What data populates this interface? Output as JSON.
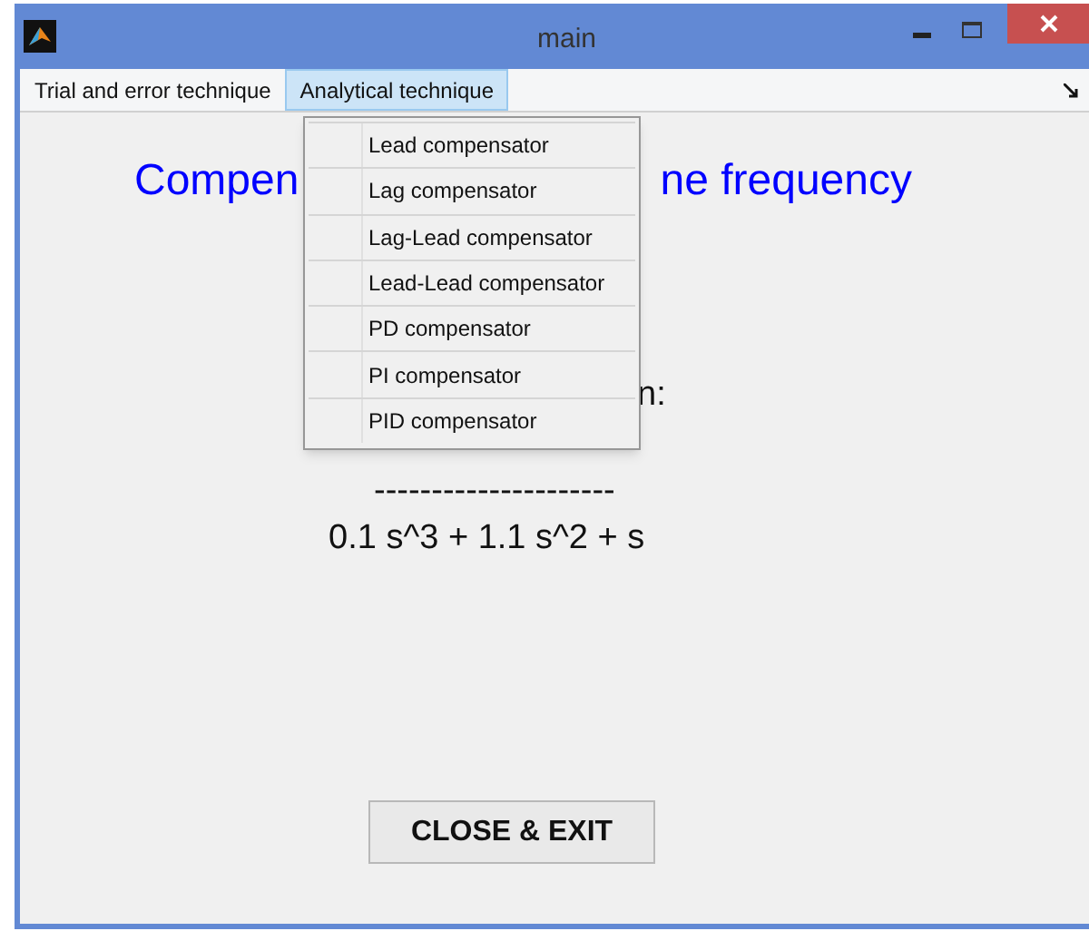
{
  "window": {
    "title": "main"
  },
  "menubar": [
    {
      "label": "Trial and error technique",
      "selected": false
    },
    {
      "label": "Analytical technique",
      "selected": true
    }
  ],
  "menu": {
    "items": [
      {
        "label": "Lead compensator"
      },
      {
        "label": "Lag compensator"
      },
      {
        "label": "Lag-Lead compensator"
      },
      {
        "label": "Lead-Lead compensator"
      },
      {
        "label": "PD compensator"
      },
      {
        "label": "PI compensator"
      },
      {
        "label": "PID compensator"
      }
    ]
  },
  "heading": {
    "left_part": "Compen",
    "right_part": "ne frequency"
  },
  "transfer_function": {
    "label_part": "n:",
    "fraction_bar": "---------------------",
    "denominator": "0.1 s^3 + 1.1 s^2 + s"
  },
  "close_button": {
    "label": "CLOSE & EXIT"
  }
}
